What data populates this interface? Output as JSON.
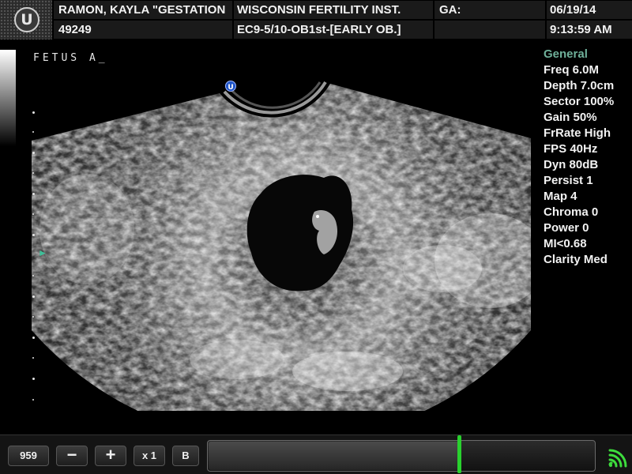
{
  "header": {
    "patient_name": "RAMON, KAYLA \"GESTATION",
    "patient_id": "49249",
    "institution": "WISCONSIN FERTILITY INST.",
    "exam": "EC9-5/10-OB1st-[EARLY OB.]",
    "ga_label": "GA:",
    "ga_value": "",
    "date": "06/19/14",
    "time": "9:13:59 AM",
    "logo_letter": "U"
  },
  "annotation": "FETUS A_",
  "probe_marker": "U",
  "parameters": {
    "title": "General",
    "rows": [
      "Freq 6.0M",
      "Depth 7.0cm",
      "Sector 100%",
      "Gain 50%",
      "FrRate High",
      "FPS 40Hz",
      "Dyn 80dB",
      "Persist 1",
      "Map 4",
      "Chroma 0",
      "Power 0",
      "MI<0.68",
      "Clarity Med"
    ]
  },
  "toolbar": {
    "frame_number": "959",
    "minus_label": "−",
    "plus_label": "+",
    "zoom_label": "x 1",
    "mode_label": "B",
    "cine_progress": 0.65
  },
  "icons": {
    "logo": "u-logo-icon",
    "focus": "focus-marker-icon",
    "signal": "wireless-signal-icon"
  },
  "colors": {
    "accent_title": "#6fb09a",
    "cine_handle": "#29d12e",
    "focus_marker": "#3fbf99",
    "probe_marker": "#1e54c8"
  }
}
